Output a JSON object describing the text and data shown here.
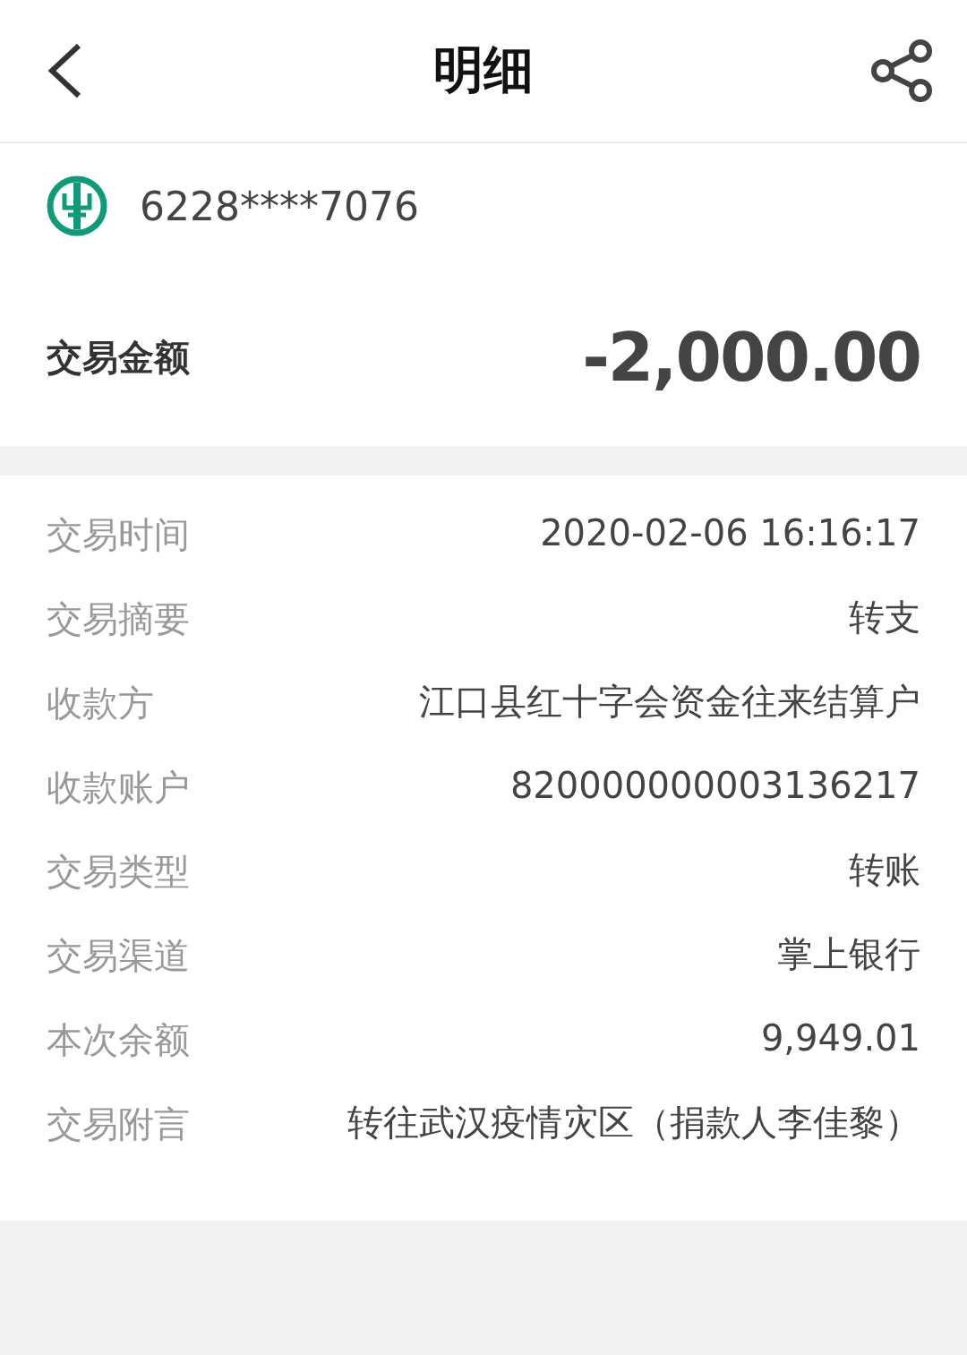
{
  "header": {
    "title": "明细"
  },
  "account": {
    "number": "6228****7076"
  },
  "amount": {
    "label": "交易金额",
    "value": "-2,000.00"
  },
  "details": [
    {
      "label": "交易时间",
      "value": "2020-02-06 16:16:17"
    },
    {
      "label": "交易摘要",
      "value": "转支"
    },
    {
      "label": "收款方",
      "value": "江口县红十字会资金往来结算户"
    },
    {
      "label": "收款账户",
      "value": "820000000003136217"
    },
    {
      "label": "交易类型",
      "value": "转账"
    },
    {
      "label": "交易渠道",
      "value": "掌上银行"
    },
    {
      "label": "本次余额",
      "value": "9,949.01"
    },
    {
      "label": "交易附言",
      "value": "转往武汉疫情灾区（捐款人李佳黎）"
    }
  ]
}
